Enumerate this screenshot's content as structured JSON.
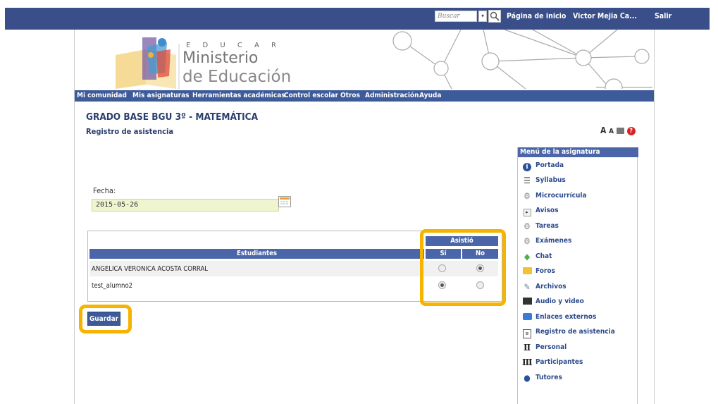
{
  "topbar": {
    "search_placeholder": "Buscar",
    "home_link": "Página de inicio",
    "user_name": "Victor Mejia Ca...",
    "logout": "Salir"
  },
  "logo": {
    "line1": "E D U C A R",
    "line2": "Ministerio",
    "line3": "de Educación"
  },
  "nav": {
    "items": [
      "Mi comunidad",
      "Mis asignaturas",
      "Herramientas académicas",
      "Control escolar",
      "Otros",
      "Administración",
      "Ayuda"
    ]
  },
  "course": {
    "title": "GRADO BASE BGU 3º - MATEMÁTICA",
    "subtitle": "Registro de asistencia"
  },
  "form": {
    "date_label": "Fecha:",
    "date_value": "2015-05-26"
  },
  "table": {
    "header_group": "Asistió",
    "col_students": "Estudiantes",
    "col_yes": "Sí",
    "col_no": "No",
    "rows": [
      {
        "name": "ANGELICA VERONICA ACOSTA CORRAL",
        "present": false
      },
      {
        "name": "test_alumno2",
        "present": true
      }
    ]
  },
  "save_button": "Guardar",
  "side_menu": {
    "title": "Menú de la asignatura",
    "items": [
      {
        "label": "Portada",
        "icon": "info-icon"
      },
      {
        "label": "Syllabus",
        "icon": "list-icon"
      },
      {
        "label": "Microcurrícula",
        "icon": "gears-icon"
      },
      {
        "label": "Avisos",
        "icon": "notice-icon"
      },
      {
        "label": "Tareas",
        "icon": "gears-icon"
      },
      {
        "label": "Exámenes",
        "icon": "gears-icon"
      },
      {
        "label": "Chat",
        "icon": "chat-icon"
      },
      {
        "label": "Foros",
        "icon": "folder-icon"
      },
      {
        "label": "Archivos",
        "icon": "files-icon"
      },
      {
        "label": "Audio y video",
        "icon": "film-icon"
      },
      {
        "label": "Enlaces externos",
        "icon": "link-icon"
      },
      {
        "label": "Registro de asistencia",
        "icon": "register-icon"
      },
      {
        "label": "Personal",
        "icon": "personal-icon"
      },
      {
        "label": "Participantes",
        "icon": "participants-icon"
      },
      {
        "label": "Tutores",
        "icon": "user-icon"
      }
    ]
  },
  "colors": {
    "topbar": "#3a4f89",
    "nav": "#3d5a99",
    "highlight": "#f5b400",
    "date_field": "#eef5cf"
  }
}
